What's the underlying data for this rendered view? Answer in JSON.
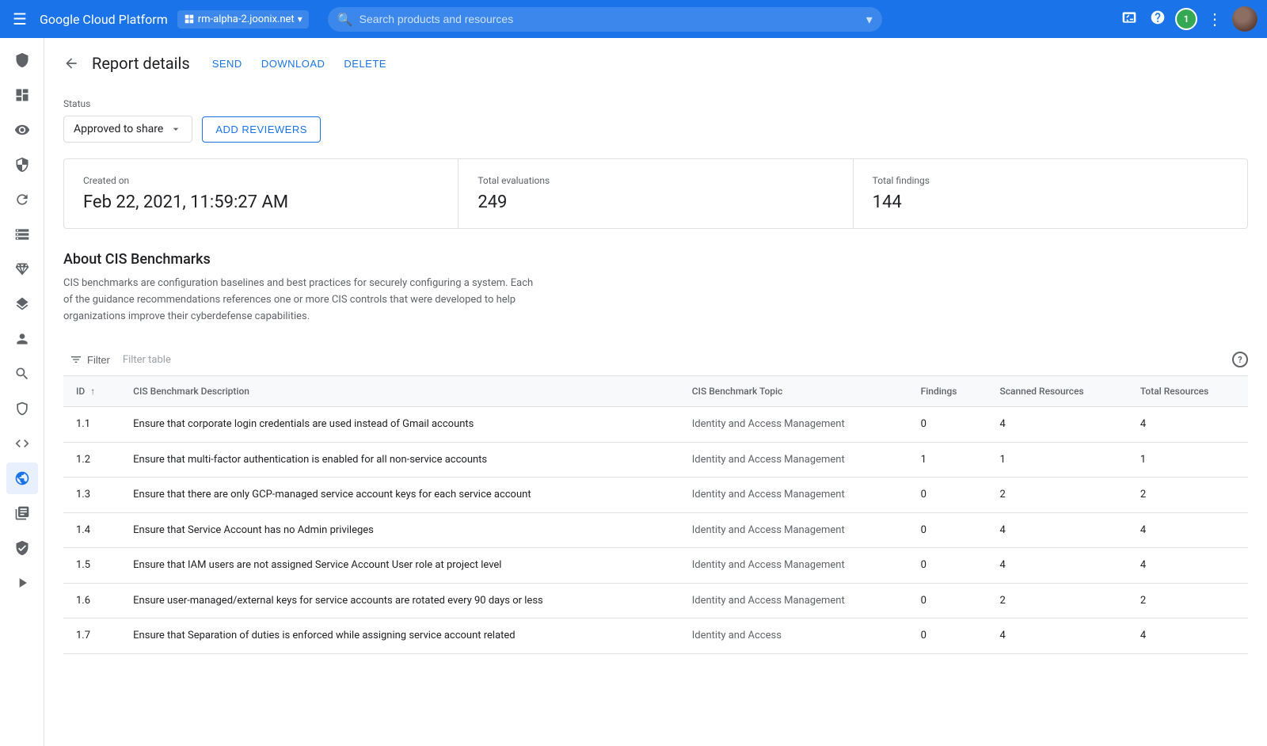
{
  "topnav": {
    "hamburger_label": "☰",
    "brand_name": "Google Cloud Platform",
    "project_name": "rm-alpha-2.joonix.net",
    "search_placeholder": "Search products and resources",
    "notification_count": "1"
  },
  "page": {
    "title": "Report details",
    "actions": {
      "send": "SEND",
      "download": "DOWNLOAD",
      "delete": "DELETE"
    }
  },
  "status": {
    "label": "Status",
    "current": "Approved to share",
    "add_reviewers_label": "ADD REVIEWERS"
  },
  "stats": {
    "created_on_label": "Created on",
    "created_on_value": "Feb 22, 2021, 11:59:27 AM",
    "total_evaluations_label": "Total evaluations",
    "total_evaluations_value": "249",
    "total_findings_label": "Total findings",
    "total_findings_value": "144"
  },
  "about": {
    "title": "About CIS Benchmarks",
    "text": "CIS benchmarks are configuration baselines and best practices for securely configuring a system. Each of the guidance recommendations references one or more CIS controls that were developed to help organizations improve their cyberdefense capabilities."
  },
  "filter": {
    "label": "Filter",
    "placeholder": "Filter table"
  },
  "table": {
    "columns": [
      {
        "key": "id",
        "label": "ID",
        "sortable": true
      },
      {
        "key": "description",
        "label": "CIS Benchmark Description",
        "sortable": false
      },
      {
        "key": "topic",
        "label": "CIS Benchmark Topic",
        "sortable": false
      },
      {
        "key": "findings",
        "label": "Findings",
        "sortable": false
      },
      {
        "key": "scanned",
        "label": "Scanned Resources",
        "sortable": false
      },
      {
        "key": "total",
        "label": "Total Resources",
        "sortable": false
      }
    ],
    "rows": [
      {
        "id": "1.1",
        "description": "Ensure that corporate login credentials are used instead of Gmail accounts",
        "topic": "Identity and Access Management",
        "findings": "0",
        "scanned": "4",
        "total": "4"
      },
      {
        "id": "1.2",
        "description": "Ensure that multi-factor authentication is enabled for all non-service accounts",
        "topic": "Identity and Access Management",
        "findings": "1",
        "scanned": "1",
        "total": "1"
      },
      {
        "id": "1.3",
        "description": "Ensure that there are only GCP-managed service account keys for each service account",
        "topic": "Identity and Access Management",
        "findings": "0",
        "scanned": "2",
        "total": "2"
      },
      {
        "id": "1.4",
        "description": "Ensure that Service Account has no Admin privileges",
        "topic": "Identity and Access Management",
        "findings": "0",
        "scanned": "4",
        "total": "4"
      },
      {
        "id": "1.5",
        "description": "Ensure that IAM users are not assigned Service Account User role at project level",
        "topic": "Identity and Access Management",
        "findings": "0",
        "scanned": "4",
        "total": "4"
      },
      {
        "id": "1.6",
        "description": "Ensure user-managed/external keys for service accounts are rotated every 90 days or less",
        "topic": "Identity and Access Management",
        "findings": "0",
        "scanned": "2",
        "total": "2"
      },
      {
        "id": "1.7",
        "description": "Ensure that Separation of duties is enforced while assigning service account related",
        "topic": "Identity and Access",
        "findings": "0",
        "scanned": "4",
        "total": "4"
      }
    ]
  },
  "sidebar": {
    "items": [
      {
        "name": "shield",
        "icon": "shield",
        "active": false
      },
      {
        "name": "dashboard",
        "icon": "dashboard",
        "active": false
      },
      {
        "name": "visibility",
        "icon": "visibility",
        "active": false
      },
      {
        "name": "security",
        "icon": "security",
        "active": false
      },
      {
        "name": "refresh",
        "icon": "refresh",
        "active": false
      },
      {
        "name": "storage",
        "icon": "storage",
        "active": false
      },
      {
        "name": "diamond",
        "icon": "diamond",
        "active": false
      },
      {
        "name": "layers",
        "icon": "layers",
        "active": false
      },
      {
        "name": "person",
        "icon": "person",
        "active": false
      },
      {
        "name": "search-circle",
        "icon": "search-circle",
        "active": false
      },
      {
        "name": "shield2",
        "icon": "shield2",
        "active": false
      },
      {
        "name": "code",
        "icon": "code",
        "active": false
      },
      {
        "name": "globe",
        "icon": "globe",
        "active": true
      },
      {
        "name": "search-list",
        "icon": "search-list",
        "active": false
      },
      {
        "name": "shield3",
        "icon": "shield3",
        "active": false
      },
      {
        "name": "arrow-right",
        "icon": "arrow-right",
        "active": false
      }
    ]
  }
}
